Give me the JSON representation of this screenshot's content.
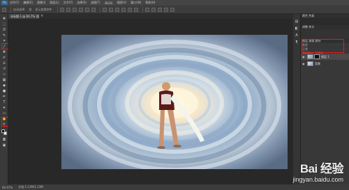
{
  "app": {
    "logo_text": "Ps"
  },
  "menu": {
    "items": [
      "文件(F)",
      "编辑(E)",
      "图像(I)",
      "图层(L)",
      "文字(Y)",
      "选择(S)",
      "滤镜(T)",
      "3D(D)",
      "视图(V)",
      "窗口(W)",
      "帮助(H)"
    ]
  },
  "options": {
    "labels": [
      "自动选择:",
      "组",
      "显示变换控件"
    ]
  },
  "document": {
    "tab_label": "未标题-1 @ 66.7% (图层 1, RGB/8)",
    "close_glyph": "×"
  },
  "panels": {
    "top_head": "颜色  色板",
    "adjust_head": "调整  样式",
    "layers_head": "图层  通道  路径",
    "kind_filter": "类型",
    "blend_mode": "正常",
    "opacity": "不透明度: 100%",
    "fill": "填充: 100%",
    "layers": [
      {
        "name": "图层 1",
        "has_mask": true,
        "selected": true
      },
      {
        "name": "背景",
        "has_mask": false,
        "selected": false
      }
    ]
  },
  "status": {
    "zoom": "66.67%",
    "doc_info": "文档:1.13M/1.13M"
  },
  "watermark": {
    "logo": "Bai 经验",
    "url": "jingyan.baidu.com"
  },
  "colors": {
    "highlight": "#e21b1b",
    "ps_blue": "#2b6ca3",
    "foreground": "#000000",
    "background": "#ffffff"
  }
}
